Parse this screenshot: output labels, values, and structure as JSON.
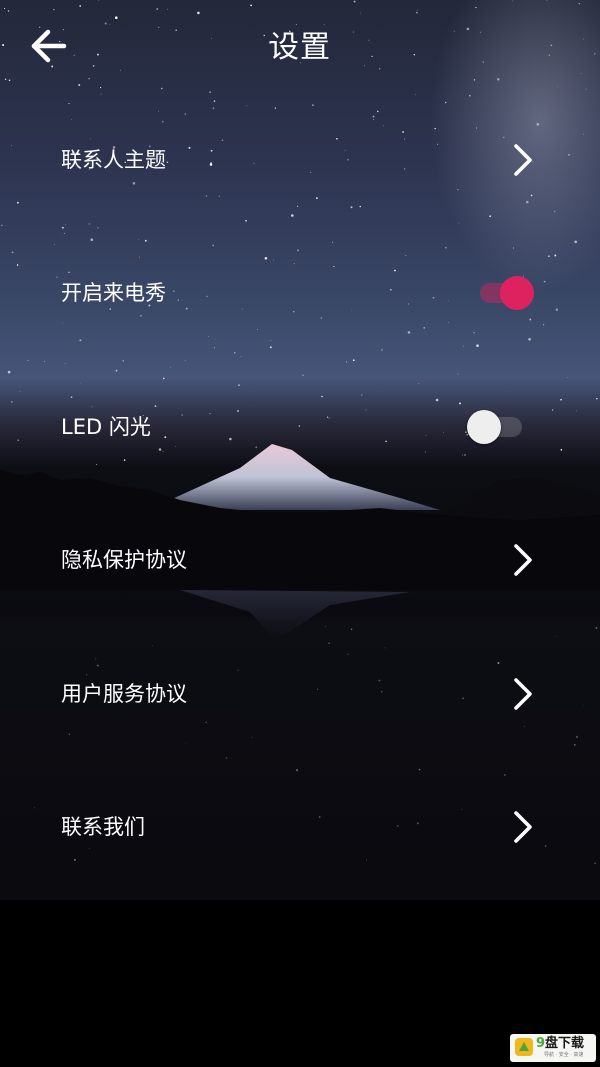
{
  "header": {
    "title": "设置",
    "back_icon": "arrow-left-icon"
  },
  "rows": [
    {
      "label": "联系人主题",
      "control": "chevron"
    },
    {
      "label": "开启来电秀",
      "control": "toggle",
      "on": true
    },
    {
      "label": "LED 闪光",
      "control": "toggle",
      "on": false
    },
    {
      "label": "隐私保护协议",
      "control": "chevron"
    },
    {
      "label": "用户服务协议",
      "control": "chevron"
    },
    {
      "label": "联系我们",
      "control": "chevron"
    }
  ],
  "colors": {
    "toggle_on": "#de2260",
    "toggle_off_knob": "#eeeeee",
    "text": "#ffffff"
  },
  "watermark": {
    "brand_first": "9",
    "brand_rest": "盘下载",
    "tagline": "导航 · 安全 · 高速"
  }
}
